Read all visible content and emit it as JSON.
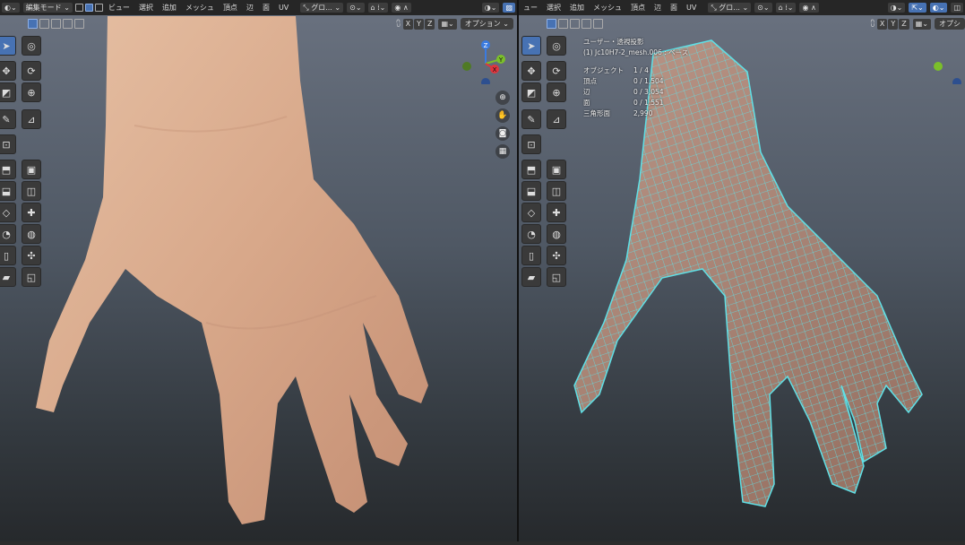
{
  "header_left": {
    "mode": "編集モード",
    "menus": [
      "ビュー",
      "選択",
      "追加",
      "メッシュ",
      "頂点",
      "辺",
      "面",
      "UV"
    ],
    "transform_orientation": "グロ..."
  },
  "header_right": {
    "menus": [
      "ュー",
      "選択",
      "追加",
      "メッシュ",
      "頂点",
      "辺",
      "面",
      "UV"
    ],
    "transform_orientation": "グロ..."
  },
  "mirror_axes": [
    "X",
    "Y",
    "Z"
  ],
  "options_left": "オプション",
  "options_right": "オプシ",
  "gizmo_axes": {
    "x": "X",
    "y": "Y",
    "z": "Z"
  },
  "colors": {
    "accent": "#4772b3",
    "wire": "#5fe0e6",
    "axis_x": "#e0353d",
    "axis_y": "#7bbf2a",
    "axis_z": "#3a7be0"
  },
  "tools": [
    "select-box-icon",
    "cursor-icon",
    "move-icon",
    "rotate-icon",
    "scale-icon",
    "transform-icon",
    "annotate-icon",
    "measure-icon",
    "add-cube-icon",
    "extrude-icon",
    "extrude-manifold-icon",
    "inset-icon",
    "bevel-icon",
    "loop-cut-icon",
    "knife-icon",
    "poly-build-icon",
    "spin-icon",
    "smooth-icon",
    "randomize-icon",
    "edge-slide-icon",
    "shrink-fatten-icon",
    "shear-icon",
    "rip-icon"
  ],
  "viewport_info": {
    "view": "ユーザー・透視投影",
    "object_line": "(1) Jc10H7-2_mesh.006 : ベース",
    "stats": [
      {
        "label": "オブジェクト",
        "value": "1 / 4"
      },
      {
        "label": "頂点",
        "value": "0 / 1,504"
      },
      {
        "label": "辺",
        "value": "0 / 3,054"
      },
      {
        "label": "面",
        "value": "0 / 1,551"
      },
      {
        "label": "三角形面",
        "value": "2,990"
      }
    ]
  }
}
